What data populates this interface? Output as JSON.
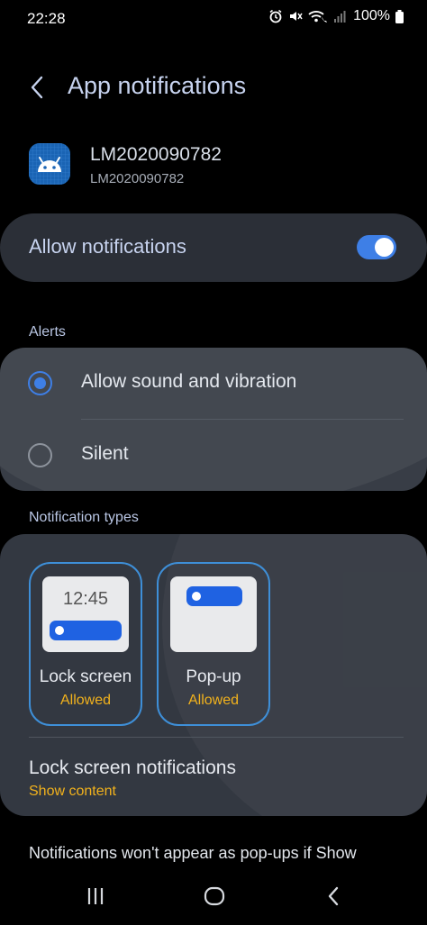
{
  "status_bar": {
    "time": "22:28",
    "battery_text": "100%",
    "icons": [
      "alarm-icon",
      "mute-icon",
      "wifi-calling-icon",
      "signal-icon",
      "battery-icon"
    ]
  },
  "header": {
    "title": "App notifications",
    "back_icon": "chevron-left-icon"
  },
  "app": {
    "name": "LM2020090782",
    "package": "LM2020090782",
    "icon": "android-icon"
  },
  "allow_notifications": {
    "label": "Allow notifications",
    "enabled": true
  },
  "alerts": {
    "section_title": "Alerts",
    "options": [
      {
        "label": "Allow sound and vibration",
        "selected": true
      },
      {
        "label": "Silent",
        "selected": false
      }
    ]
  },
  "notification_types": {
    "section_title": "Notification types",
    "types": [
      {
        "title": "Lock screen",
        "status": "Allowed",
        "preview_time": "12:45"
      },
      {
        "title": "Pop-up",
        "status": "Allowed"
      }
    ],
    "lock_screen_notifications": {
      "title": "Lock screen notifications",
      "value": "Show content"
    }
  },
  "footer_note": "Notifications won't appear as pop-ups if Show",
  "colors": {
    "accent": "#3e7fe6",
    "status_allowed": "#f2b21c",
    "card": "#2b2f37"
  },
  "nav_bar": {
    "icons": [
      "recents-icon",
      "home-icon",
      "back-icon"
    ]
  }
}
